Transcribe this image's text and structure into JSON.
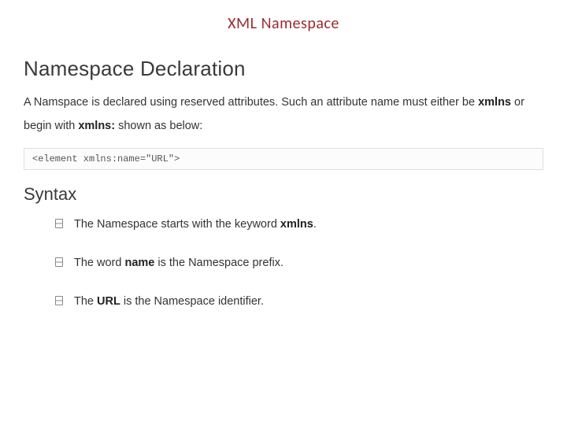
{
  "title": "XML Namespace",
  "heading": "Namespace Declaration",
  "intro": {
    "prefix": "A Namspace is declared using reserved attributes. Such an attribute name must either be ",
    "bold1": "xmlns",
    "mid": " or begin with ",
    "bold2": "xmlns:",
    "suffix": " shown as below:"
  },
  "code": "<element xmlns:name=\"URL\">",
  "syntax_heading": "Syntax",
  "bullets": [
    {
      "pre": "The Namespace starts with the keyword ",
      "bold": "xmlns",
      "post": "."
    },
    {
      "pre": "The word ",
      "bold": "name",
      "post": " is the Namespace prefix."
    },
    {
      "pre": "The ",
      "bold": "URL",
      "post": " is the Namespace identifier."
    }
  ]
}
